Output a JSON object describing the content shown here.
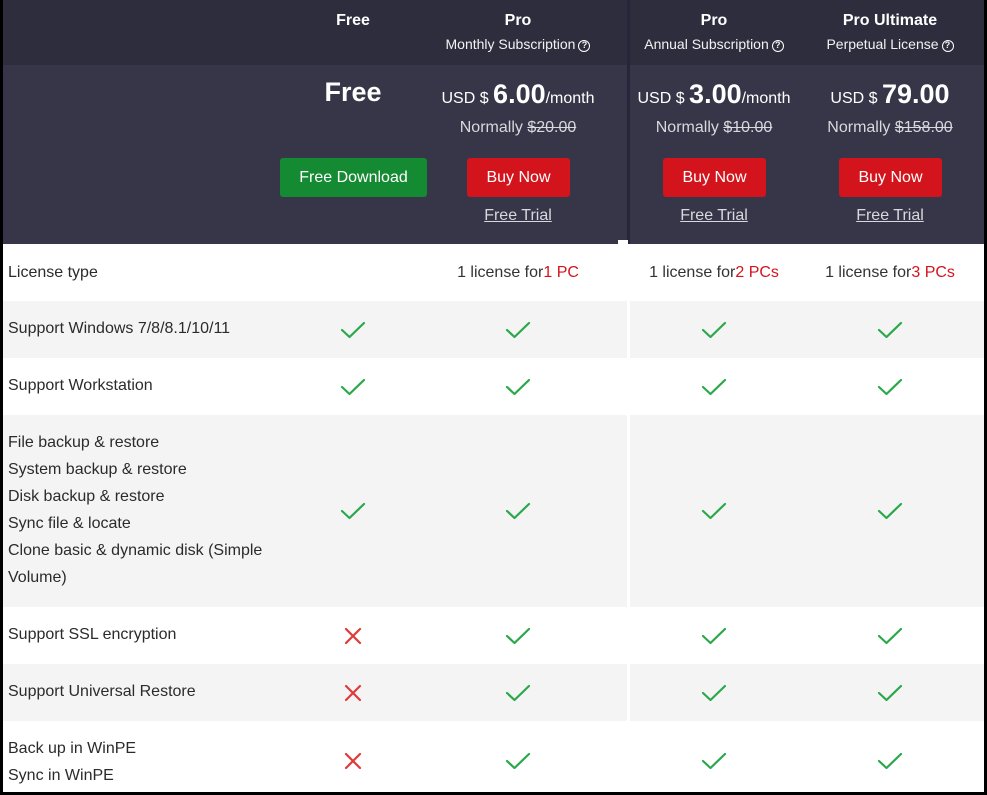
{
  "plans": [
    {
      "name": "Free",
      "subtitle": "",
      "price_prefix": "",
      "price": "Free",
      "price_suffix": "",
      "normally_label": "",
      "normally_price": "",
      "button": "Free Download",
      "trial": ""
    },
    {
      "name": "Pro",
      "subtitle": "Monthly Subscription",
      "price_prefix": "USD $ ",
      "price": "6.00",
      "price_suffix": "/month",
      "normally_label": "Normally ",
      "normally_price": "$20.00",
      "button": "Buy Now",
      "trial": "Free Trial"
    },
    {
      "name": "Pro",
      "subtitle": "Annual Subscription",
      "price_prefix": "USD $ ",
      "price": "3.00",
      "price_suffix": "/month",
      "normally_label": "Normally ",
      "normally_price": "$10.00",
      "button": "Buy Now",
      "trial": "Free Trial"
    },
    {
      "name": "Pro Ultimate",
      "subtitle": "Perpetual License",
      "price_prefix": "USD $ ",
      "price": "79.00",
      "price_suffix": "",
      "normally_label": "Normally ",
      "normally_price": "$158.00",
      "button": "Buy Now",
      "trial": "Free Trial"
    }
  ],
  "help_icon": "question-circle-icon",
  "colors": {
    "header_dark": "#2d2d3d",
    "header": "#363648",
    "green_button": "#148a32",
    "red_button": "#d4141c",
    "check": "#2aa84a",
    "cross": "#e03a3a"
  },
  "license_row": {
    "label": "License type",
    "cells": [
      {
        "prefix": "",
        "highlight": ""
      },
      {
        "prefix": "1 license for ",
        "highlight": "1 PC"
      },
      {
        "prefix": "1 license for ",
        "highlight": "2 PCs"
      },
      {
        "prefix": "1 license for ",
        "highlight": "3 PCs"
      }
    ]
  },
  "features": [
    {
      "lines": [
        "Support Windows 7/8/8.1/10/11"
      ],
      "values": [
        true,
        true,
        true,
        true
      ]
    },
    {
      "lines": [
        "Support Workstation"
      ],
      "values": [
        true,
        true,
        true,
        true
      ]
    },
    {
      "lines": [
        "File backup & restore",
        "System backup & restore",
        "Disk backup & restore",
        "Sync file & locate",
        "Clone basic & dynamic disk (Simple",
        "Volume)"
      ],
      "values": [
        true,
        true,
        true,
        true
      ]
    },
    {
      "lines": [
        "Support SSL encryption"
      ],
      "values": [
        false,
        true,
        true,
        true
      ]
    },
    {
      "lines": [
        "Support Universal Restore"
      ],
      "values": [
        false,
        true,
        true,
        true
      ]
    },
    {
      "lines": [
        "Back up in WinPE",
        "Sync in WinPE"
      ],
      "values": [
        false,
        true,
        true,
        true
      ]
    }
  ]
}
